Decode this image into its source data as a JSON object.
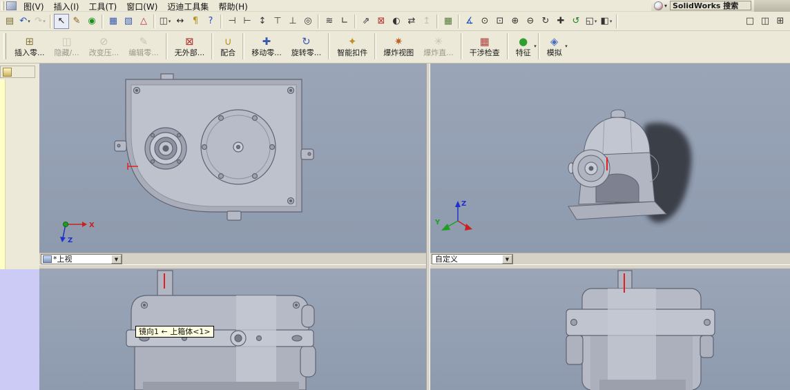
{
  "menu_bar": {
    "items": [
      {
        "name": "view",
        "label": "图(V)"
      },
      {
        "name": "insert",
        "label": "插入(I)"
      },
      {
        "name": "tools",
        "label": "工具(T)"
      },
      {
        "name": "window",
        "label": "窗口(W)"
      },
      {
        "name": "maidi-toolkit",
        "label": "迈迪工具集"
      },
      {
        "name": "help",
        "label": "帮助(H)"
      }
    ],
    "search_placeholder": "SolidWorks 搜索"
  },
  "icons": {
    "dropdown_arrow": "▾",
    "combo_arrow": "▼"
  },
  "standard_toolbar": {
    "buttons": [
      {
        "name": "new-document",
        "glyph": "▤",
        "color": "#7a6a30"
      },
      {
        "name": "undo",
        "glyph": "↶",
        "color": "#1f4fc0",
        "dd": true
      },
      {
        "name": "redo",
        "glyph": "↷",
        "color": "#8a8a84",
        "dd": true,
        "disabled": true
      },
      {
        "sep": true
      },
      {
        "name": "select",
        "glyph": "↖",
        "color": "#1a1a1a",
        "active": true
      },
      {
        "name": "sketch-pencil",
        "glyph": "✎",
        "color": "#8a5a20"
      },
      {
        "name": "rebuild-traffic-light",
        "glyph": "◉",
        "color": "#1f8f1f"
      },
      {
        "sep": true
      },
      {
        "name": "grid",
        "glyph": "▦",
        "color": "#3a5ab0"
      },
      {
        "name": "sketch",
        "glyph": "▧",
        "color": "#3a5ab0"
      },
      {
        "name": "3d-sketch",
        "glyph": "△",
        "color": "#b03030"
      },
      {
        "sep": true
      },
      {
        "name": "viewport-pane",
        "glyph": "◫",
        "color": "#444444",
        "dd": true
      },
      {
        "name": "dimension",
        "glyph": "↔",
        "color": "#222222"
      },
      {
        "name": "note",
        "glyph": "¶",
        "color": "#b09020"
      },
      {
        "name": "help",
        "glyph": "?",
        "color": "#1f4fc0"
      },
      {
        "sep": true
      },
      {
        "name": "measure-caliper",
        "glyph": "⊣",
        "color": "#333333"
      },
      {
        "name": "caliper-inside",
        "glyph": "⊢",
        "color": "#333333"
      },
      {
        "name": "caliper-vertical",
        "glyph": "↕",
        "color": "#333333"
      },
      {
        "name": "caliper-depth",
        "glyph": "⊤",
        "color": "#333333"
      },
      {
        "name": "thread-callout",
        "glyph": "⊥",
        "color": "#333333"
      },
      {
        "name": "hole-callout",
        "glyph": "◎",
        "color": "#333333"
      },
      {
        "sep": true
      },
      {
        "name": "surface-finish",
        "glyph": "≋",
        "color": "#333333"
      },
      {
        "name": "datum-corner",
        "glyph": "∟",
        "color": "#333333"
      },
      {
        "sep": true
      },
      {
        "name": "flip-direction",
        "glyph": "⇗",
        "color": "#333333"
      },
      {
        "name": "delete-face",
        "glyph": "⊠",
        "color": "#b03030"
      },
      {
        "name": "curvature",
        "glyph": "◐",
        "color": "#333333"
      },
      {
        "name": "swap-arrows",
        "glyph": "⇄",
        "color": "#333333"
      },
      {
        "name": "move-up",
        "glyph": "↥",
        "color": "#888888",
        "disabled": true
      },
      {
        "sep": true
      },
      {
        "name": "design-table",
        "glyph": "▦",
        "color": "#567a3a"
      },
      {
        "sep": true
      },
      {
        "name": "measure",
        "glyph": "∡",
        "color": "#1f4fc0"
      },
      {
        "name": "zoom-fit",
        "glyph": "⊙",
        "color": "#333333"
      },
      {
        "name": "zoom-area",
        "glyph": "⊡",
        "color": "#333333"
      },
      {
        "name": "zoom-in",
        "glyph": "⊕",
        "color": "#333333"
      },
      {
        "name": "zoom-out",
        "glyph": "⊖",
        "color": "#333333"
      },
      {
        "name": "rotate-view",
        "glyph": "↻",
        "color": "#333333"
      },
      {
        "name": "pan",
        "glyph": "✚",
        "color": "#333333"
      },
      {
        "name": "refresh-view",
        "glyph": "↺",
        "color": "#1f7f1f"
      },
      {
        "name": "standard-views",
        "glyph": "◱",
        "color": "#333333",
        "dd": true
      },
      {
        "name": "section-view",
        "glyph": "◧",
        "color": "#333333",
        "dd": true
      },
      {
        "sep": true
      },
      {
        "name": "viewport-single",
        "glyph": "□",
        "color": "#333333",
        "push_right": true
      },
      {
        "name": "viewport-two",
        "glyph": "◫",
        "color": "#333333"
      },
      {
        "name": "viewport-four",
        "glyph": "⊞",
        "color": "#333333"
      }
    ]
  },
  "assembly_toolbar": {
    "buttons": [
      {
        "name": "insert-component",
        "label": "插入零...",
        "glyph": "⊞",
        "color": "#8a7a40"
      },
      {
        "name": "hide-show-component",
        "label": "隐藏/...",
        "glyph": "◫",
        "color": "#888888",
        "disabled": true
      },
      {
        "name": "change-suppression",
        "label": "改变压...",
        "glyph": "⊘",
        "color": "#888888",
        "disabled": true
      },
      {
        "name": "edit-component",
        "label": "编辑零...",
        "glyph": "✎",
        "color": "#888888",
        "disabled": true
      },
      {
        "sep": true
      },
      {
        "name": "no-external-references",
        "label": "无外部...",
        "glyph": "⊠",
        "color": "#b03030"
      },
      {
        "sep": true
      },
      {
        "name": "mate",
        "label": "配合",
        "glyph": "∪",
        "color": "#c09020"
      },
      {
        "sep": true
      },
      {
        "name": "move-component",
        "label": "移动零...",
        "glyph": "✚",
        "color": "#3a5ab0"
      },
      {
        "name": "rotate-component",
        "label": "旋转零...",
        "glyph": "↻",
        "color": "#3a5ab0"
      },
      {
        "sep": true
      },
      {
        "name": "smart-fasteners",
        "label": "智能扣件",
        "glyph": "✦",
        "color": "#c09020"
      },
      {
        "sep": true
      },
      {
        "name": "exploded-view",
        "label": "爆炸视图",
        "glyph": "✷",
        "color": "#c06020"
      },
      {
        "name": "explode-line-sketch",
        "label": "爆炸直...",
        "glyph": "✳",
        "color": "#888888",
        "disabled": true
      },
      {
        "sep": true
      },
      {
        "name": "interference-detection",
        "label": "干涉检查",
        "glyph": "▦",
        "color": "#b04040"
      },
      {
        "sep": true
      },
      {
        "name": "features",
        "label": "特征",
        "glyph": "●",
        "color": "#2f9f2f",
        "dd": true
      },
      {
        "sep": true
      },
      {
        "name": "simulate",
        "label": "模拟",
        "glyph": "◈",
        "color": "#4a6ac0",
        "dd": true
      }
    ]
  },
  "viewports": {
    "top_left": {
      "view_label": "*上视",
      "axis_x_label": "X",
      "axis_z_label": "Z"
    },
    "top_right": {
      "view_label": "自定义",
      "axis_z_label": "Z",
      "axis_y_label": "Y"
    },
    "bottom_left": {
      "tooltip": "镜向1  ←  上箱体<1>"
    },
    "bottom_right": {}
  },
  "colors": {
    "toolbar_bg": "#ECE9D8",
    "viewport_bg": "#93A0B4",
    "model_fill": "#B6BAC6",
    "model_edge": "#5F6370",
    "tooltip_bg": "#FFFFE1",
    "axis_x": "#CC2020",
    "axis_y": "#1F9F1F",
    "axis_z": "#2030CC",
    "sketch_mark": "#E02020",
    "left_panel_lower": "#CBCBF6",
    "collapsed_strip": "#FFFFC6"
  }
}
